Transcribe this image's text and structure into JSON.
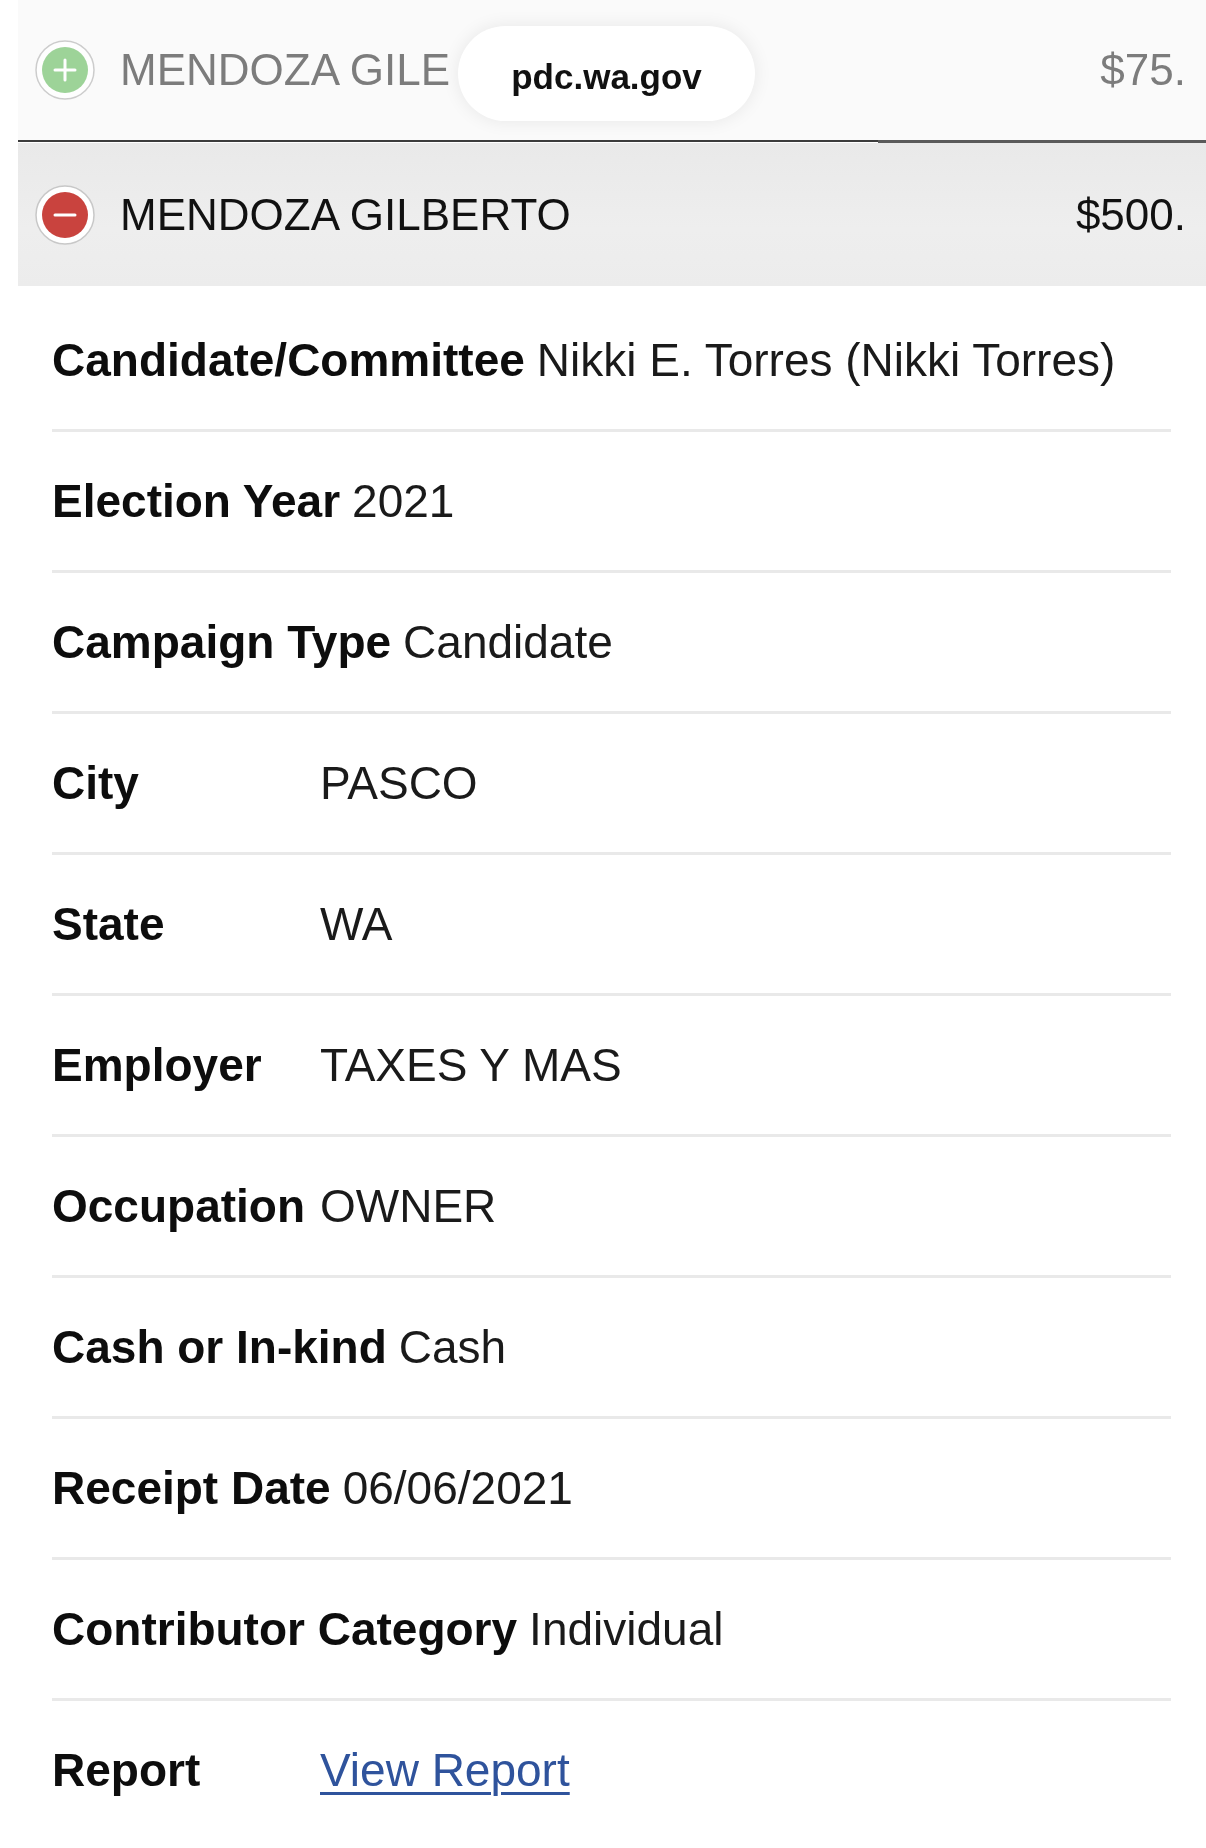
{
  "browser": {
    "url": "pdc.wa.gov"
  },
  "contributions": [
    {
      "contributor": "MENDOZA GILE",
      "amount": "$75.",
      "expanded": false
    },
    {
      "contributor": "MENDOZA GILBERTO",
      "amount": "$500.",
      "expanded": true,
      "details": [
        {
          "label": "Candidate/Committee",
          "value": "Nikki E. Torres (Nikki Torres)",
          "kind": "text"
        },
        {
          "label": "Election Year",
          "value": "2021",
          "kind": "text"
        },
        {
          "label": "Campaign Type",
          "value": "Candidate",
          "kind": "text"
        },
        {
          "label": "City",
          "value": "PASCO",
          "kind": "text"
        },
        {
          "label": "State",
          "value": "WA",
          "kind": "text"
        },
        {
          "label": "Employer",
          "value": "TAXES Y MAS",
          "kind": "text"
        },
        {
          "label": "Occupation",
          "value": "OWNER",
          "kind": "text"
        },
        {
          "label": "Cash or In-kind",
          "value": "Cash",
          "kind": "text"
        },
        {
          "label": "Receipt Date",
          "value": "06/06/2021",
          "kind": "text"
        },
        {
          "label": "Contributor Category",
          "value": "Individual",
          "kind": "text"
        },
        {
          "label": "Report",
          "value": "View Report",
          "kind": "link"
        }
      ]
    }
  ]
}
